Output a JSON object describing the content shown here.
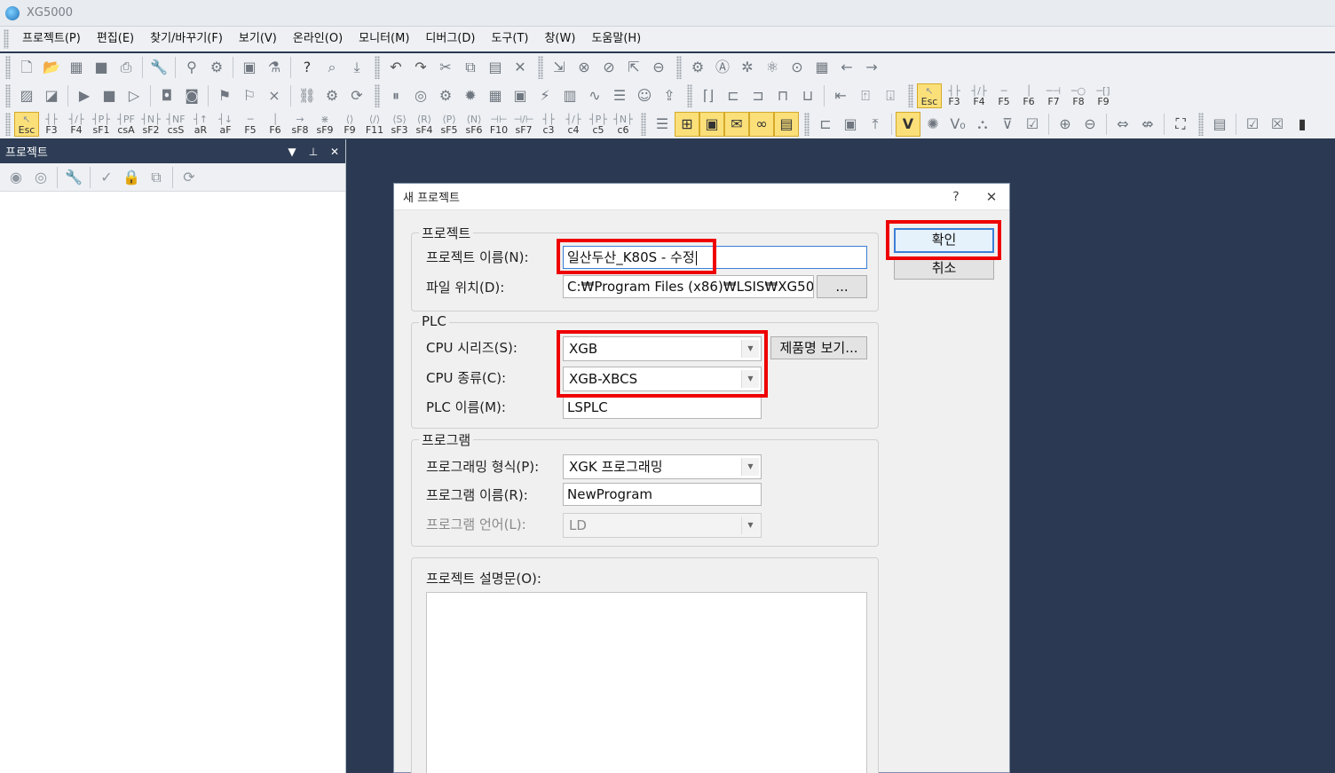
{
  "window": {
    "title": "XG5000"
  },
  "menu": [
    "프로젝트(P)",
    "편집(E)",
    "찾기/바꾸기(F)",
    "보기(V)",
    "온라인(O)",
    "모니터(M)",
    "디버그(D)",
    "도구(T)",
    "창(W)",
    "도움말(H)"
  ],
  "toolbar": {
    "row3_keys": [
      "Esc",
      "F3",
      "F4",
      "sF1",
      "csA",
      "sF2",
      "csS",
      "aR",
      "aF",
      "F5",
      "F6",
      "sF8",
      "sF9",
      "F9",
      "F11",
      "sF3",
      "sF4",
      "sF5",
      "sF6",
      "F10",
      "sF7",
      "c3",
      "c4",
      "c5",
      "c6"
    ],
    "row2_keys": [
      "Esc",
      "F3",
      "F4",
      "F5",
      "F6",
      "F7",
      "F8",
      "F9"
    ],
    "v_label": "V"
  },
  "project_panel": {
    "title": "프로젝트"
  },
  "dialog": {
    "title": "새 프로젝트",
    "help": "?",
    "close": "✕",
    "ok": "확인",
    "cancel": "취소",
    "project_group": "프로젝트",
    "project_name_label": "프로젝트 이름(N):",
    "project_name_value": "일산두산_K80S - 수정",
    "file_location_label": "파일 위치(D):",
    "file_location_value": "C:₩Program Files (x86)₩LSIS₩XG5000",
    "browse": "...",
    "plc_group": "PLC",
    "cpu_series_label": "CPU 시리즈(S):",
    "cpu_series_value": "XGB",
    "product_view": "제품명 보기...",
    "cpu_type_label": "CPU 종류(C):",
    "cpu_type_value": "XGB-XBCS",
    "plc_name_label": "PLC 이름(M):",
    "plc_name_value": "LSPLC",
    "program_group": "프로그램",
    "programming_type_label": "프로그래밍 형식(P):",
    "programming_type_value": "XGK 프로그래밍",
    "program_name_label": "프로그램 이름(R):",
    "program_name_value": "NewProgram",
    "program_language_label": "프로그램 언어(L):",
    "program_language_value": "LD",
    "description_label": "프로젝트 설명문(O):"
  },
  "colors": {
    "highlight": "#ee0000",
    "workspace": "#2b3a52",
    "panel_header": "#2e3d55"
  }
}
